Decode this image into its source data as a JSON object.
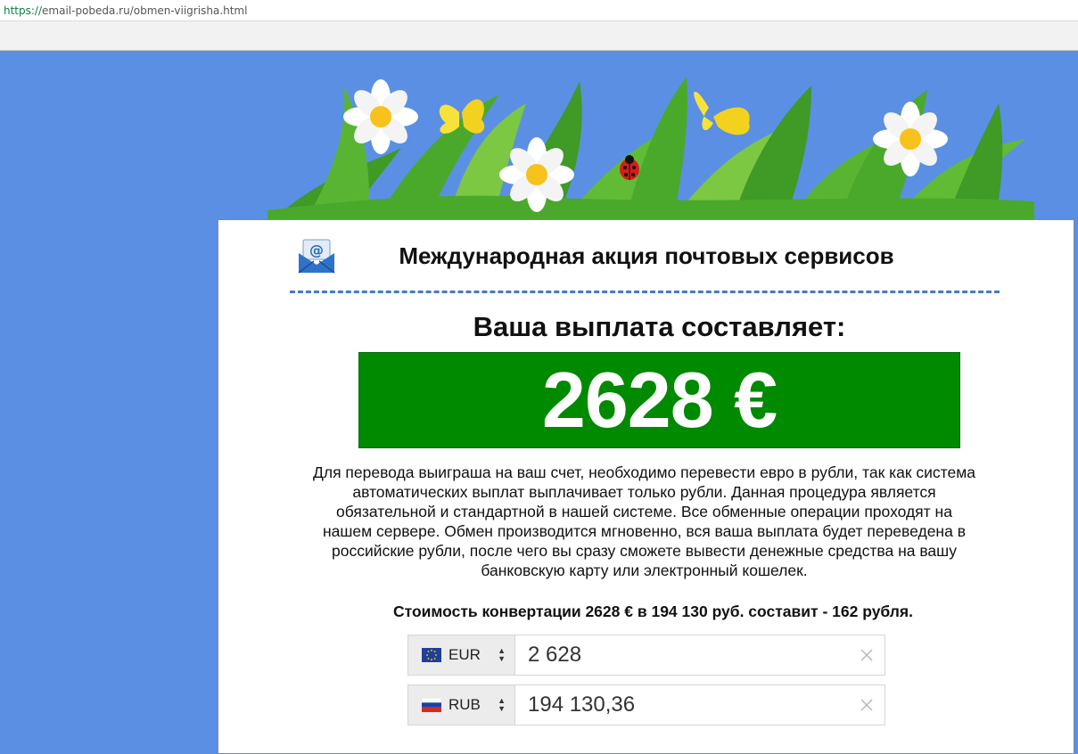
{
  "browser": {
    "url_scheme": "https://",
    "url_rest": "email-pobeda.ru/obmen-viigrisha.html"
  },
  "page": {
    "headline": "Международная акция почтовых сервисов",
    "payout_label": "Ваша выплата составляет:",
    "payout_amount": "2628 €",
    "description": "Для перевода выиграша на ваш счет, необходимо перевести евро в рубли, так как система автоматических выплат выплачивает только рубли. Данная процедура является обязательной и стандартной в нашей системе. Все обменные операции проходят на нашем сервере. Обмен производится мгновенно, вся ваша выплата будет переведена в российские рубли, после чего вы сразу сможете вывести денежные средства на вашу банковскую карту или электронный кошелек.",
    "conversion_note": "Стоимость конвертации 2628 € в 194 130 руб. составит - 162 рубля."
  },
  "converter": {
    "from": {
      "currency": "EUR",
      "flag": "eu-flag-icon",
      "amount": "2 628"
    },
    "to": {
      "currency": "RUB",
      "flag": "ru-flag-icon",
      "amount": "194 130,36"
    }
  },
  "colors": {
    "page_background": "#5b8fe4",
    "amount_box": "#008a00",
    "dash_line": "#4a78c8"
  }
}
